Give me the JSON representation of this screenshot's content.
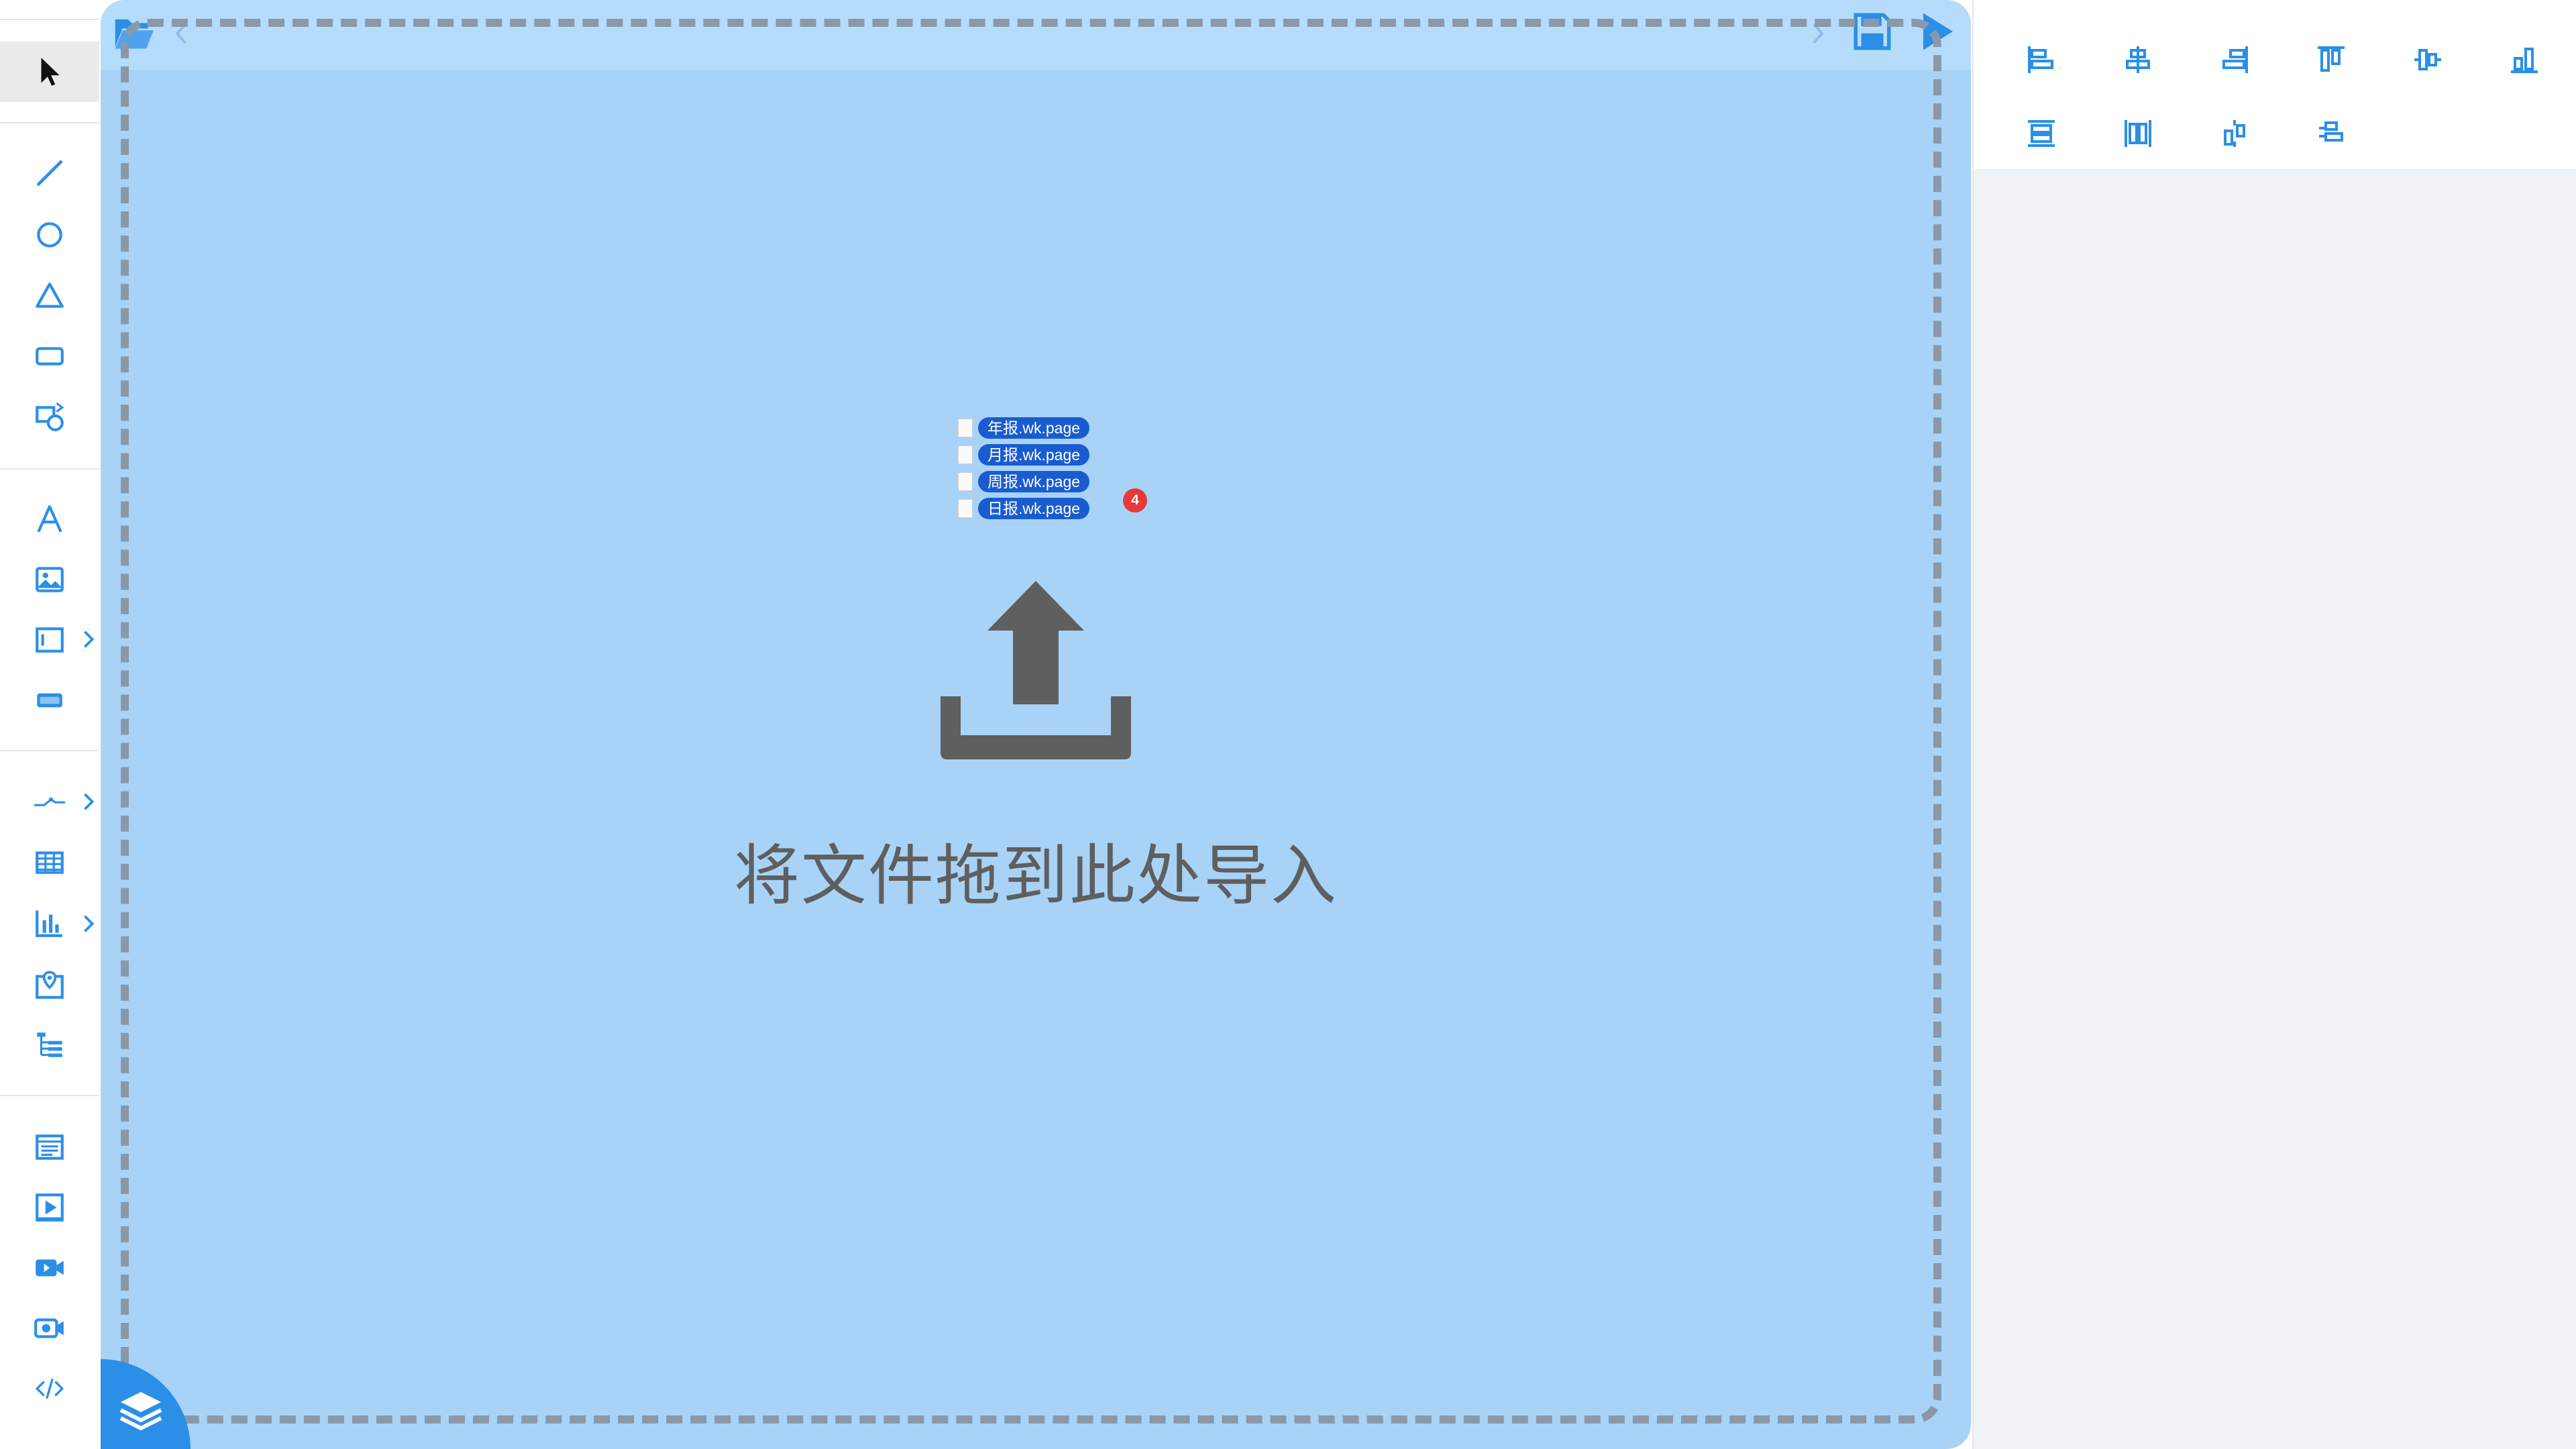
{
  "app": {
    "accent_color": "#2b8fe8",
    "canvas_color": "#a8d3f7"
  },
  "sidebar": {
    "tools": [
      {
        "name": "pointer-icon"
      },
      {
        "name": "line-icon"
      },
      {
        "name": "circle-icon"
      },
      {
        "name": "triangle-icon"
      },
      {
        "name": "rectangle-icon"
      },
      {
        "name": "shapes-icon"
      },
      {
        "name": "text-icon"
      },
      {
        "name": "image-icon"
      },
      {
        "name": "frame-icon"
      },
      {
        "name": "button-shape-icon"
      },
      {
        "name": "connector-icon"
      },
      {
        "name": "table-icon"
      },
      {
        "name": "chart-icon"
      },
      {
        "name": "map-icon"
      },
      {
        "name": "tree-icon"
      },
      {
        "name": "webpage-icon"
      },
      {
        "name": "video-player-icon"
      },
      {
        "name": "video-icon"
      },
      {
        "name": "camera-icon"
      },
      {
        "name": "code-icon"
      }
    ]
  },
  "drop_zone": {
    "dragged_files": [
      "年报.wk.page",
      "月报.wk.page",
      "周报.wk.page",
      "日报.wk.page"
    ],
    "file_count": "4",
    "message": "将文件拖到此处导入"
  },
  "align_toolbar": {
    "buttons": [
      "align-left-icon",
      "align-center-horizontal-icon",
      "align-right-icon",
      "align-top-icon",
      "align-center-vertical-icon",
      "align-bottom-icon",
      "distribute-vertical-icon",
      "distribute-horizontal-icon",
      "distribute-center-icon",
      "distribute-stack-icon"
    ]
  }
}
